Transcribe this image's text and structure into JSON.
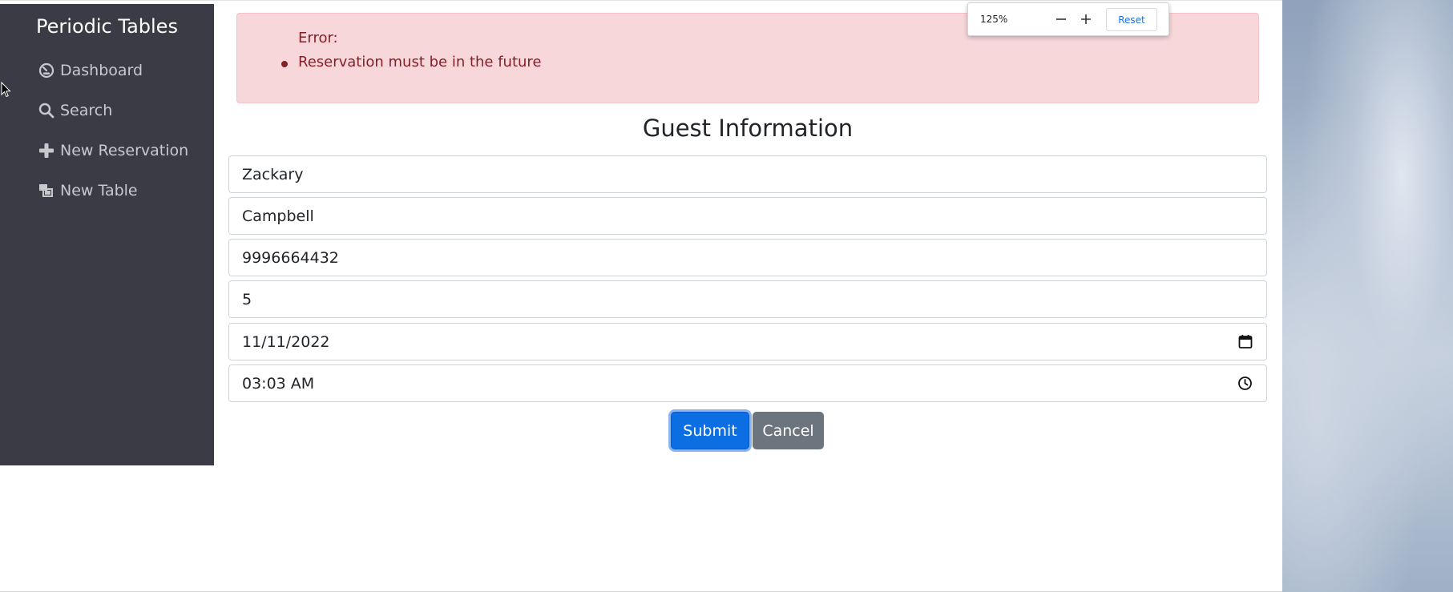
{
  "sidebar": {
    "brand": "Periodic Tables",
    "items": [
      {
        "label": "Dashboard",
        "icon": "dashboard-icon"
      },
      {
        "label": "Search",
        "icon": "search-icon"
      },
      {
        "label": "New Reservation",
        "icon": "plus-icon"
      },
      {
        "label": "New Table",
        "icon": "table-icon"
      }
    ]
  },
  "alert": {
    "title": "Error:",
    "messages": [
      "Reservation must be in the future"
    ]
  },
  "form": {
    "title": "Guest Information",
    "first_name": "Zackary",
    "last_name": "Campbell",
    "mobile_number": "9996664432",
    "people": "5",
    "reservation_date": "11/11/2022",
    "reservation_time": "03:03 AM",
    "submit_label": "Submit",
    "cancel_label": "Cancel"
  },
  "zoom": {
    "level": "125%",
    "reset_label": "Reset"
  },
  "colors": {
    "sidebar_bg": "#3b3b45",
    "alert_bg": "#f8d7da",
    "alert_text": "#842029",
    "submit_bg": "#0b6fe3",
    "cancel_bg": "#6c757d"
  }
}
